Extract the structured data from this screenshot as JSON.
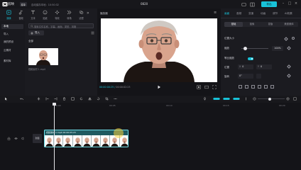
{
  "titlebar": {
    "app_title": "剪映",
    "menu_label": "菜单",
    "autosave": "自动保存本地：10:50:32",
    "project_name": "0820",
    "export_label": "导出"
  },
  "left_panel": {
    "tabs": [
      {
        "label": "媒体",
        "icon": "media-icon"
      },
      {
        "label": "音频",
        "icon": "audio-icon"
      },
      {
        "label": "文本",
        "icon": "text-icon"
      },
      {
        "label": "贴纸",
        "icon": "sticker-icon"
      },
      {
        "label": "特效",
        "icon": "effects-icon"
      },
      {
        "label": "转场",
        "icon": "transition-icon"
      },
      {
        "label": "滤镜",
        "icon": "filter-icon"
      }
    ],
    "subnav": [
      "本地",
      "导入",
      "我的预设",
      "云素材",
      "素材库"
    ],
    "search_placeholder": "搜索文件名称、字幕、画面、类型、风格",
    "import_label": "导入",
    "folder_label": "全部",
    "thumb_caption": "视频素材 1.mp4"
  },
  "player": {
    "title": "播放器",
    "timecode_current": "00:00:00:25",
    "timecode_total": "00:00:02:23"
  },
  "right_panel": {
    "tabs": [
      "画面",
      "音频",
      "变速",
      "动画",
      "调节",
      "AI效果"
    ],
    "subtabs": [
      "基础",
      "抠像",
      "蒙版",
      "美颜美体"
    ],
    "section_label": "位置大小",
    "scale_label": "缩放",
    "scale_value": "100%",
    "uniform_label": "等比缩放",
    "position_label": "位置",
    "x_axis": "X",
    "x_value": "0",
    "y_axis": "Y",
    "y_value": "0",
    "rotate_label": "旋转",
    "rotate_value": "0°"
  },
  "timeline": {
    "ruler_labels": [
      "00:00",
      "00:05",
      "00:10",
      "00:15",
      "00:20",
      "00:25"
    ],
    "cover_label": "封面",
    "clip_label": "视频素材 1.mp4  00:00:05:23"
  },
  "colors": {
    "accent": "#18c2d8",
    "clip_fill": "#1f5a60"
  }
}
